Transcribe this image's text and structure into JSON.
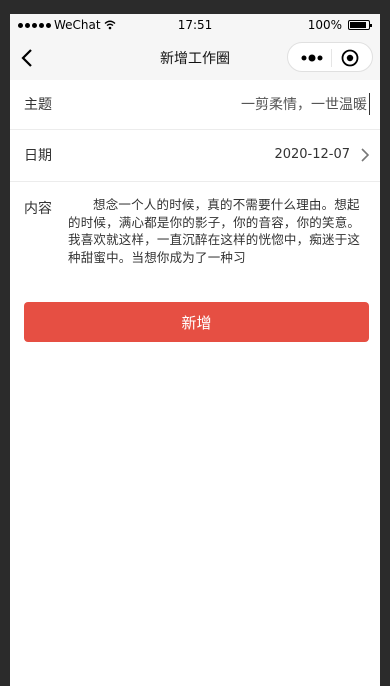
{
  "status_bar": {
    "carrier": "WeChat",
    "time": "17:51",
    "battery": "100%"
  },
  "navbar": {
    "title": "新增工作圈"
  },
  "form": {
    "theme": {
      "label": "主题",
      "value": "一剪柔情，一世温暖"
    },
    "date": {
      "label": "日期",
      "value": "2020-12-07"
    },
    "content": {
      "label": "内容",
      "value": "想念一个人的时候，真的不需要什么理由。想起的时候，满心都是你的影子，你的音容，你的笑意。我喜欢就这样，一直沉醉在这样的恍惚中，痴迷于这种甜蜜中。当想你成为了一种习"
    }
  },
  "submit_label": "新增",
  "colors": {
    "accent": "#e64f43"
  }
}
